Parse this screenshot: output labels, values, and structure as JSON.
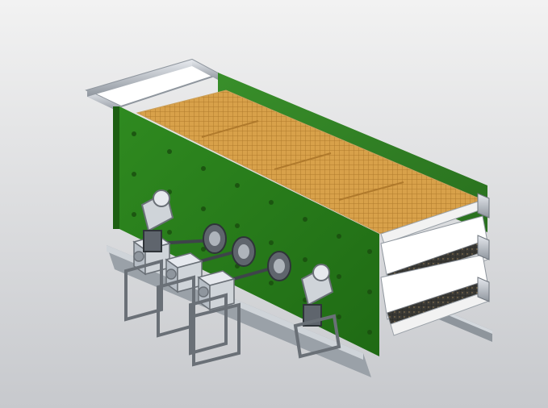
{
  "scene": {
    "subject": "vibrating-screen-cad-render",
    "colors": {
      "background_top": "#f2f2f2",
      "background_bottom": "#c7c9cd",
      "frame_green": "#2e8b1f",
      "frame_green_dark": "#1f6a14",
      "mesh_orange": "#d8a14a",
      "mesh_dark": "#3b3a36",
      "steel_light": "#d7dbe0",
      "steel_mid": "#aeb4bb",
      "steel_dark": "#5f656d"
    }
  }
}
